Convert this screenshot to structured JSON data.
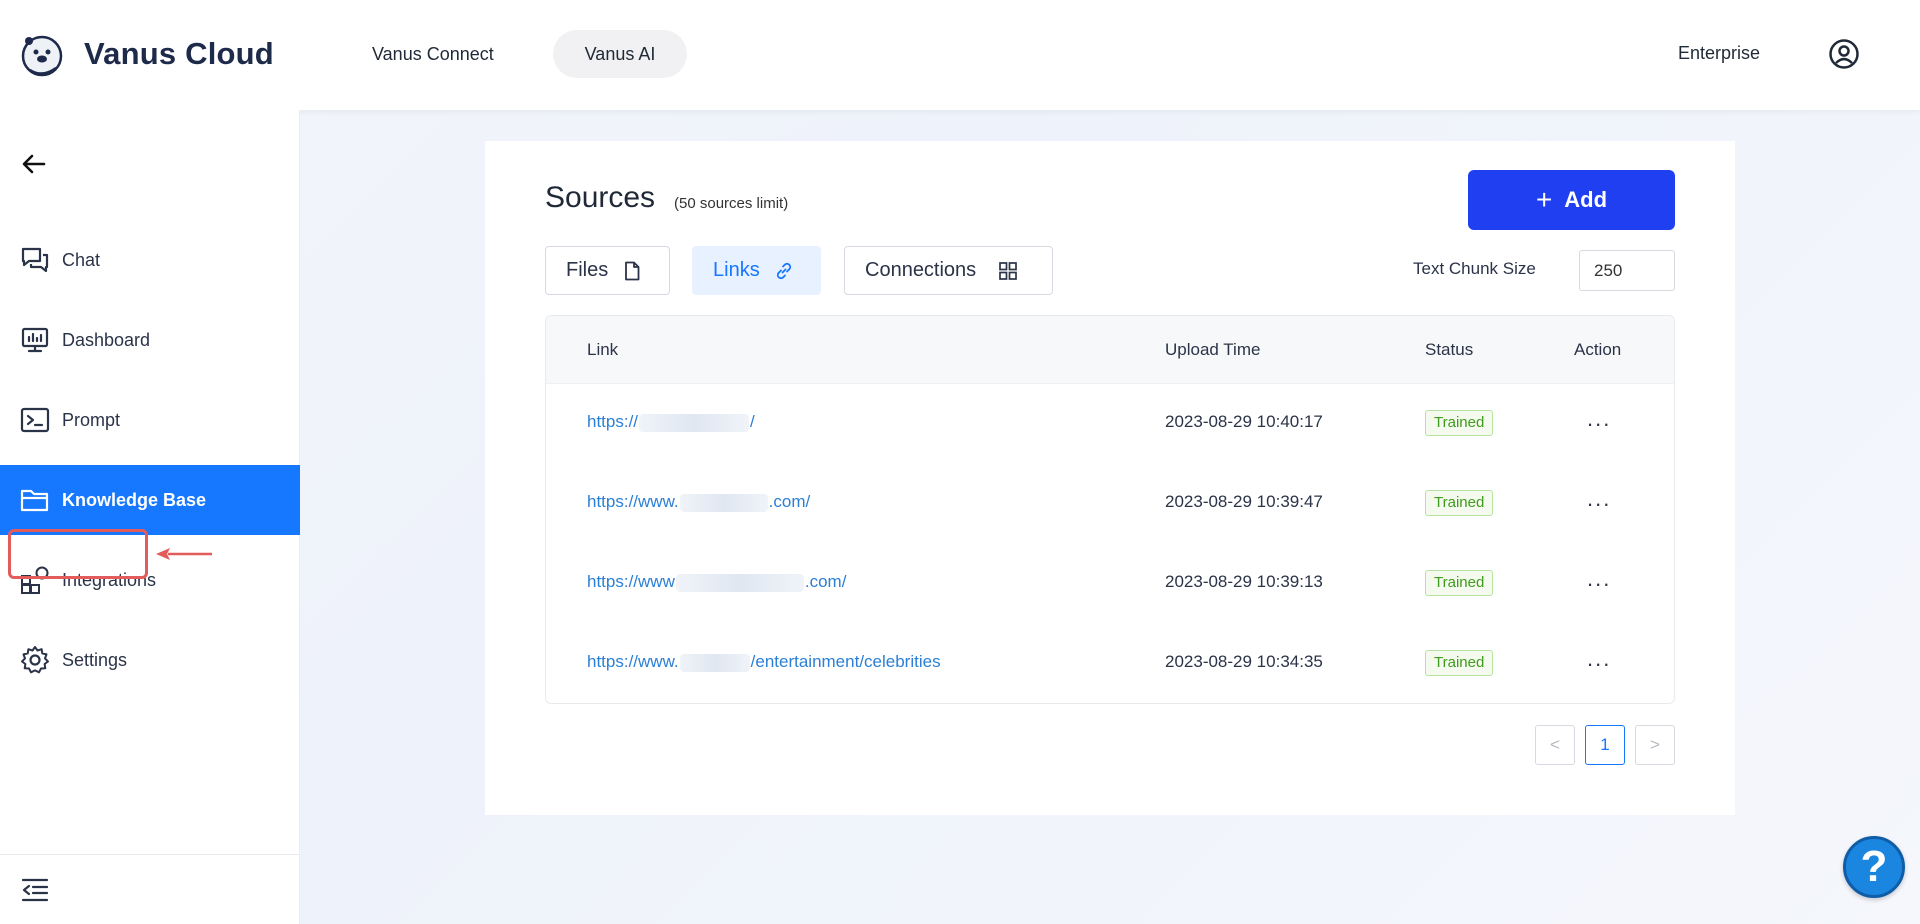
{
  "header": {
    "brand": "Vanus Cloud",
    "nav": [
      {
        "label": "Vanus Connect"
      },
      {
        "label": "Vanus AI"
      }
    ],
    "plan": "Enterprise",
    "icons": {
      "logo": "otter-logo-icon",
      "user": "user-circle-icon"
    }
  },
  "sidebar": {
    "items": [
      {
        "label": "Chat",
        "icon": "chat-icon"
      },
      {
        "label": "Dashboard",
        "icon": "dashboard-icon"
      },
      {
        "label": "Prompt",
        "icon": "terminal-icon"
      },
      {
        "label": "Knowledge Base",
        "icon": "folder-icon",
        "active": true
      },
      {
        "label": "Integrations",
        "icon": "integrations-icon"
      },
      {
        "label": "Settings",
        "icon": "gear-icon",
        "highlighted": true
      }
    ]
  },
  "sources": {
    "title": "Sources",
    "limit": "(50 sources limit)",
    "add_label": "Add",
    "tabs": [
      {
        "label": "Files",
        "icon": "file-icon"
      },
      {
        "label": "Links",
        "icon": "link-icon",
        "active": true
      },
      {
        "label": "Connections",
        "icon": "grid-icon"
      }
    ],
    "chunk_label": "Text Chunk Size",
    "chunk_value": "250",
    "columns": [
      "Link",
      "Upload Time",
      "Status",
      "Action"
    ],
    "rows": [
      {
        "link_start": "https://",
        "link_end": "/",
        "time": "2023-08-29 10:40:17",
        "status": "Trained",
        "action": "..."
      },
      {
        "link_start": "https://www.",
        "link_end": ".com/",
        "time": "2023-08-29 10:39:47",
        "status": "Trained",
        "action": "..."
      },
      {
        "link_start": "https://www",
        "link_end": ".com/",
        "time": "2023-08-29 10:39:13",
        "status": "Trained",
        "action": "..."
      },
      {
        "link_start": "https://www.",
        "link_end": "/entertainment/celebrities",
        "time": "2023-08-29 10:34:35",
        "status": "Trained",
        "action": "..."
      }
    ],
    "pagination": {
      "prev": "<",
      "current": "1",
      "next": ">"
    }
  },
  "help": {
    "label": "?"
  },
  "colors": {
    "accent": "#1677ff",
    "add_button": "#1f3ff0",
    "trained": "#3e9b1c",
    "annotation": "#e45b5b"
  }
}
